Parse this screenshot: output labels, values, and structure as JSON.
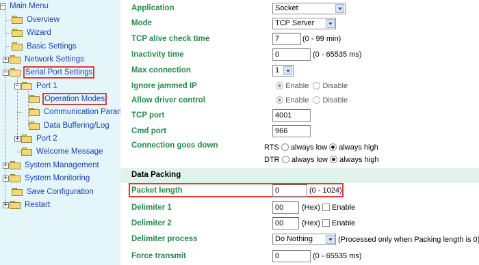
{
  "sidebar": {
    "main_menu": "Main Menu",
    "overview": "Overview",
    "wizard": "Wizard",
    "basic_settings": "Basic Settings",
    "network_settings": "Network Settings",
    "serial_port_settings": "Serial Port Settings",
    "port1": "Port 1",
    "operation_modes": "Operation Modes",
    "communication_parameters": "Communication Parame",
    "data_buffering_log": "Data Buffering/Log",
    "port2": "Port 2",
    "welcome_message": "Welcome Message",
    "system_management": "System Management",
    "system_monitoring": "System Monitoring",
    "save_configuration": "Save Configuration",
    "restart": "Restart"
  },
  "form": {
    "application": {
      "label": "Application",
      "value": "Socket"
    },
    "mode": {
      "label": "Mode",
      "value": "TCP Server"
    },
    "tcp_alive": {
      "label": "TCP alive check time",
      "value": "7",
      "hint": "(0 - 99 min)"
    },
    "inactivity": {
      "label": "Inactivity time",
      "value": "0",
      "hint": "(0 - 65535 ms)"
    },
    "max_connection": {
      "label": "Max connection",
      "value": "1"
    },
    "ignore_jammed": {
      "label": "Ignore jammed IP",
      "enable": "Enable",
      "disable": "Disable"
    },
    "allow_driver": {
      "label": "Allow driver control",
      "enable": "Enable",
      "disable": "Disable"
    },
    "tcp_port": {
      "label": "TCP port",
      "value": "4001"
    },
    "cmd_port": {
      "label": "Cmd port",
      "value": "966"
    },
    "connection_down": {
      "label": "Connection goes down",
      "rts": "RTS",
      "dtr": "DTR",
      "always_low": "always low",
      "always_high": "always high"
    }
  },
  "packing": {
    "title": "Data Packing",
    "packet_length": {
      "label": "Packet length",
      "value": "0",
      "hint": "(0 - 1024)"
    },
    "delimiter1": {
      "label": "Delimiter 1",
      "value": "00",
      "hex": "(Hex)",
      "enable": "Enable"
    },
    "delimiter2": {
      "label": "Delimiter 2",
      "value": "00",
      "hex": "(Hex)",
      "enable": "Enable"
    },
    "delimiter_process": {
      "label": "Delimiter process",
      "value": "Do Nothing",
      "hint": "(Processed only when Packing length is 0)"
    },
    "force_transmit": {
      "label": "Force transmit",
      "value": "0",
      "hint": "(0 - 65535 ms)"
    }
  },
  "colors": {
    "sidebar_bg": "#e4f6fa",
    "label_green": "#238a4c",
    "link_blue": "#1d3fb0",
    "highlight_red": "#e0393a",
    "section_bg": "#e1f1ec"
  }
}
